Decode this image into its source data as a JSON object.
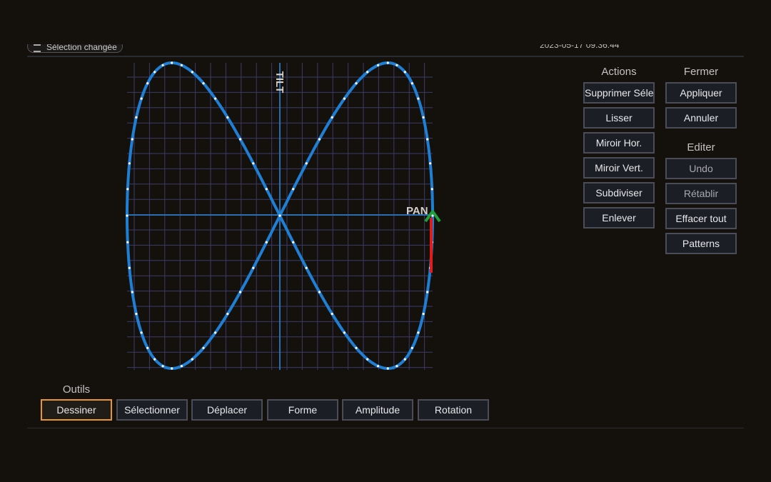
{
  "top": {
    "pill_label": "Sélection changée",
    "timestamp": "2023-05-17 09:36:44"
  },
  "editor": {
    "tilt_label": "TILT",
    "pan_label": "PAN",
    "colors": {
      "curve": "#1f7fd4",
      "grid": "#3a3a66",
      "axis": "#2a6db0",
      "points": "#ffffff",
      "start_arrow": "#1fa03a",
      "start_segment": "#e01c1c"
    },
    "pattern": {
      "shape": "figure-eight (lissajous)",
      "points": 72
    }
  },
  "actions": {
    "title": "Actions",
    "buttons": [
      "Supprimer Sélection",
      "Lisser",
      "Miroir Hor.",
      "Miroir Vert.",
      "Subdiviser",
      "Enlever"
    ]
  },
  "fermer": {
    "title": "Fermer",
    "buttons": [
      "Appliquer",
      "Annuler"
    ]
  },
  "editer": {
    "title": "Editer",
    "buttons": [
      "Undo",
      "Rétablir",
      "Effacer tout",
      "Patterns"
    ],
    "disabled": [
      "Undo",
      "Rétablir"
    ]
  },
  "outils": {
    "title": "Outils",
    "active": "Dessiner",
    "buttons": [
      "Dessiner",
      "Sélectionner",
      "Déplacer",
      "Forme",
      "Amplitude",
      "Rotation"
    ]
  }
}
